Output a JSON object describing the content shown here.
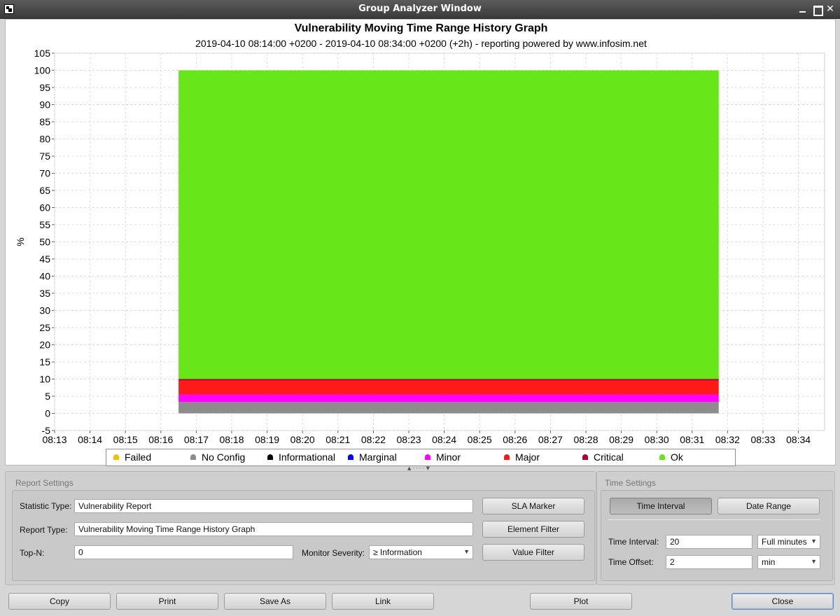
{
  "window": {
    "title": "Group Analyzer Window"
  },
  "chart_data": {
    "type": "area",
    "title": "Vulnerability Moving Time Range History Graph",
    "subtitle": "2019-04-10 08:14:00 +0200 - 2019-04-10 08:34:00 +0200 (+2h) - reporting powered by www.infosim.net",
    "xlabel": "",
    "ylabel": "%",
    "ylim": [
      -5,
      105
    ],
    "yticks": [
      -5,
      0,
      5,
      10,
      15,
      20,
      25,
      30,
      35,
      40,
      45,
      50,
      55,
      60,
      65,
      70,
      75,
      80,
      85,
      90,
      95,
      100,
      105
    ],
    "xticks": [
      "08:13",
      "08:14",
      "08:15",
      "08:16",
      "08:17",
      "08:18",
      "08:19",
      "08:20",
      "08:21",
      "08:22",
      "08:23",
      "08:24",
      "08:25",
      "08:26",
      "08:27",
      "08:28",
      "08:29",
      "08:30",
      "08:31",
      "08:32",
      "08:33",
      "08:34"
    ],
    "xlim": [
      "08:13",
      "08:34"
    ],
    "x_range": [
      "08:16:30",
      "08:31:45"
    ],
    "grid": true,
    "legend_position": "bottom",
    "stacked": true,
    "series": [
      {
        "name": "Failed",
        "color": "#f0c000",
        "value": 0
      },
      {
        "name": "No Config",
        "color": "#8c8c8c",
        "value": 3.3
      },
      {
        "name": "Informational",
        "color": "#000000",
        "value": 0
      },
      {
        "name": "Marginal",
        "color": "#0000ff",
        "value": 0
      },
      {
        "name": "Minor",
        "color": "#ff00ff",
        "value": 2.2
      },
      {
        "name": "Major",
        "color": "#ff1a1a",
        "value": 4.1
      },
      {
        "name": "Critical",
        "color": "#b0002a",
        "value": 0.4
      },
      {
        "name": "Ok",
        "color": "#66e619",
        "value": 90
      }
    ]
  },
  "report_settings": {
    "label": "Report Settings",
    "statistic_type_label": "Statistic Type:",
    "statistic_type_value": "Vulnerability Report",
    "report_type_label": "Report Type:",
    "report_type_value": "Vulnerability Moving Time Range History Graph",
    "top_n_label": "Top-N:",
    "top_n_value": "0",
    "monitor_severity_label": "Monitor Severity:",
    "monitor_severity_value": "≥ Information",
    "sla_marker": "SLA Marker",
    "element_filter": "Element Filter",
    "value_filter": "Value Filter"
  },
  "time_settings": {
    "label": "Time Settings",
    "time_interval_tab": "Time Interval",
    "date_range_tab": "Date Range",
    "time_interval_label": "Time Interval:",
    "time_interval_value": "20",
    "time_interval_unit": "Full minutes",
    "time_offset_label": "Time Offset:",
    "time_offset_value": "2",
    "time_offset_unit": "min"
  },
  "footer": {
    "copy": "Copy",
    "print": "Print",
    "save_as": "Save As",
    "link": "Link",
    "plot": "Plot",
    "close": "Close"
  }
}
